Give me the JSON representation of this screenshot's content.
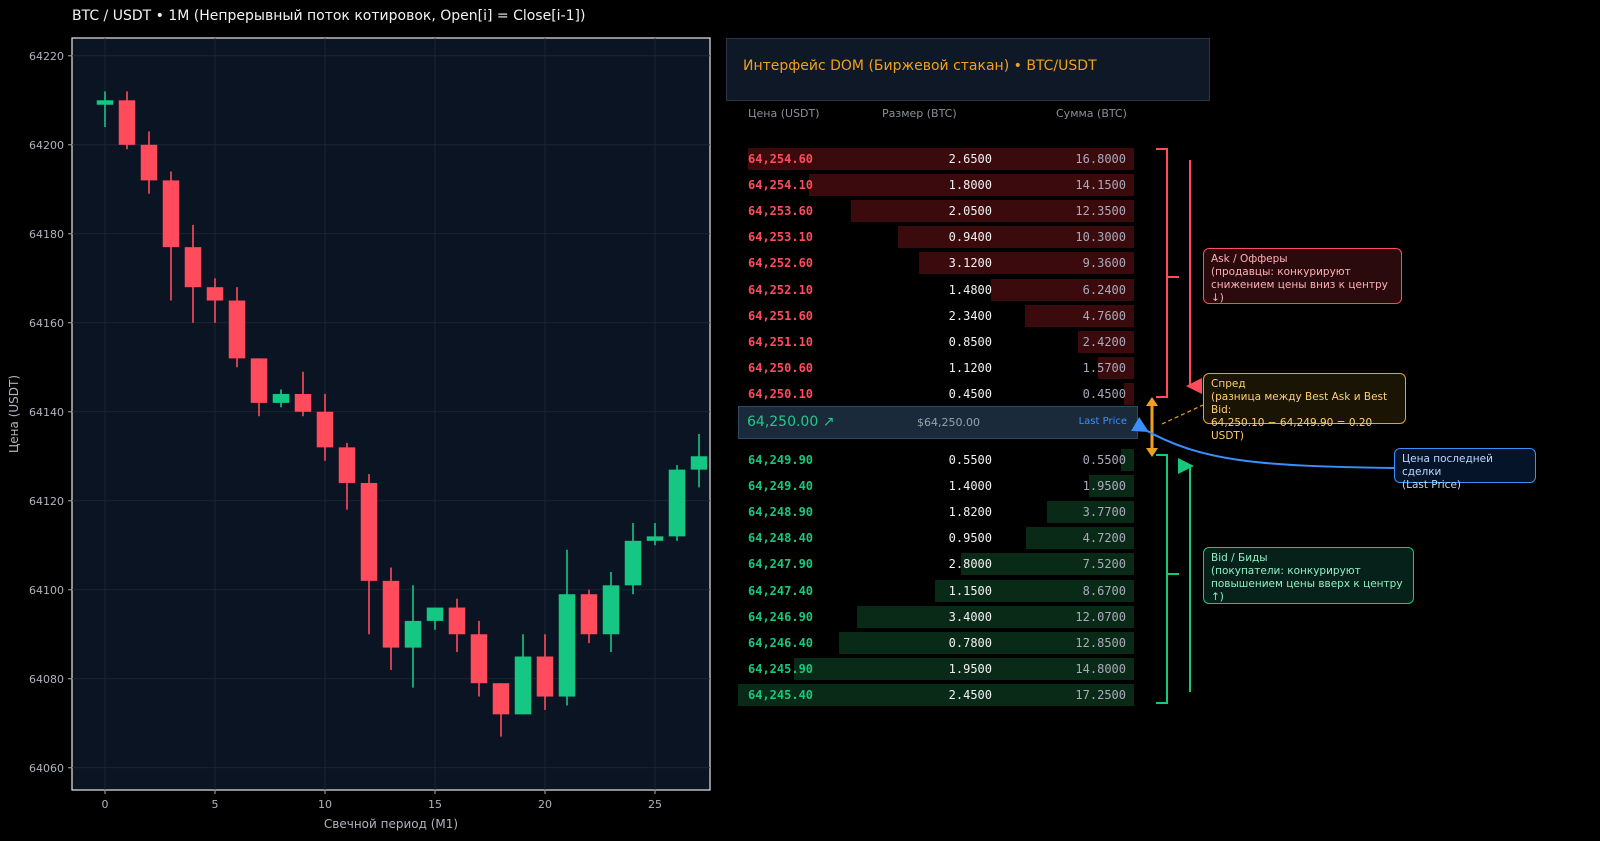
{
  "title": "BTC / USDT • 1M  (Непрерывный поток котировок, Open[i] = Close[i-1])",
  "colors": {
    "up": "#16c784",
    "down": "#ff4b5c",
    "accent": "#f0a020",
    "last": "#3a8fff",
    "background": "#000000",
    "plot_bg": "#0b1422"
  },
  "chart_data": {
    "type": "candlestick",
    "xlabel": "Свечной период (M1)",
    "ylabel": "Цена (USDT)",
    "xlim": [
      -1.5,
      27.5
    ],
    "ylim": [
      64055,
      64224
    ],
    "xticks": [
      0,
      5,
      10,
      15,
      20,
      25
    ],
    "yticks": [
      64060,
      64080,
      64100,
      64120,
      64140,
      64160,
      64180,
      64200,
      64220
    ],
    "grid": true,
    "candles": [
      {
        "x": 0,
        "open": 64209,
        "high": 64212,
        "low": 64204,
        "close": 64210
      },
      {
        "x": 1,
        "open": 64210,
        "high": 64212,
        "low": 64199,
        "close": 64200
      },
      {
        "x": 2,
        "open": 64200,
        "high": 64203,
        "low": 64189,
        "close": 64192
      },
      {
        "x": 3,
        "open": 64192,
        "high": 64194,
        "low": 64165,
        "close": 64177
      },
      {
        "x": 4,
        "open": 64177,
        "high": 64182,
        "low": 64160,
        "close": 64168
      },
      {
        "x": 5,
        "open": 64168,
        "high": 64170,
        "low": 64160,
        "close": 64165
      },
      {
        "x": 6,
        "open": 64165,
        "high": 64168,
        "low": 64150,
        "close": 64152
      },
      {
        "x": 7,
        "open": 64152,
        "high": 64152,
        "low": 64139,
        "close": 64142
      },
      {
        "x": 8,
        "open": 64142,
        "high": 64145,
        "low": 64141,
        "close": 64144
      },
      {
        "x": 9,
        "open": 64144,
        "high": 64149,
        "low": 64139,
        "close": 64140
      },
      {
        "x": 10,
        "open": 64140,
        "high": 64144,
        "low": 64129,
        "close": 64132
      },
      {
        "x": 11,
        "open": 64132,
        "high": 64133,
        "low": 64118,
        "close": 64124
      },
      {
        "x": 12,
        "open": 64124,
        "high": 64126,
        "low": 64090,
        "close": 64102
      },
      {
        "x": 13,
        "open": 64102,
        "high": 64105,
        "low": 64082,
        "close": 64087
      },
      {
        "x": 14,
        "open": 64087,
        "high": 64101,
        "low": 64078,
        "close": 64093
      },
      {
        "x": 15,
        "open": 64093,
        "high": 64096,
        "low": 64091,
        "close": 64096
      },
      {
        "x": 16,
        "open": 64096,
        "high": 64098,
        "low": 64086,
        "close": 64090
      },
      {
        "x": 17,
        "open": 64090,
        "high": 64093,
        "low": 64076,
        "close": 64079
      },
      {
        "x": 18,
        "open": 64079,
        "high": 64079,
        "low": 64067,
        "close": 64072
      },
      {
        "x": 19,
        "open": 64072,
        "high": 64090,
        "low": 64072,
        "close": 64085
      },
      {
        "x": 20,
        "open": 64085,
        "high": 64090,
        "low": 64073,
        "close": 64076
      },
      {
        "x": 21,
        "open": 64076,
        "high": 64109,
        "low": 64074,
        "close": 64099
      },
      {
        "x": 22,
        "open": 64099,
        "high": 64100,
        "low": 64088,
        "close": 64090
      },
      {
        "x": 23,
        "open": 64090,
        "high": 64104,
        "low": 64086,
        "close": 64101
      },
      {
        "x": 24,
        "open": 64101,
        "high": 64115,
        "low": 64099,
        "close": 64111
      },
      {
        "x": 25,
        "open": 64111,
        "high": 64115,
        "low": 64110,
        "close": 64112
      },
      {
        "x": 26,
        "open": 64112,
        "high": 64128,
        "low": 64111,
        "close": 64127
      },
      {
        "x": 27,
        "open": 64127,
        "high": 64135,
        "low": 64123,
        "close": 64130
      }
    ]
  },
  "dom": {
    "title": "Интерфейс DOM (Биржевой стакан) • BTC/USDT",
    "columns": [
      "Цена (USDT)",
      "Размер (BTC)",
      "Сумма (BTC)"
    ],
    "max_total": 17.25,
    "asks": [
      {
        "price": "64,254.60",
        "size": "2.6500",
        "total": "16.8000",
        "total_value": 16.8
      },
      {
        "price": "64,254.10",
        "size": "1.8000",
        "total": "14.1500",
        "total_value": 14.15
      },
      {
        "price": "64,253.60",
        "size": "2.0500",
        "total": "12.3500",
        "total_value": 12.35
      },
      {
        "price": "64,253.10",
        "size": "0.9400",
        "total": "10.3000",
        "total_value": 10.3
      },
      {
        "price": "64,252.60",
        "size": "3.1200",
        "total": "9.3600",
        "total_value": 9.36
      },
      {
        "price": "64,252.10",
        "size": "1.4800",
        "total": "6.2400",
        "total_value": 6.24
      },
      {
        "price": "64,251.60",
        "size": "2.3400",
        "total": "4.7600",
        "total_value": 4.76
      },
      {
        "price": "64,251.10",
        "size": "0.8500",
        "total": "2.4200",
        "total_value": 2.42
      },
      {
        "price": "64,250.60",
        "size": "1.1200",
        "total": "1.5700",
        "total_value": 1.57
      },
      {
        "price": "64,250.10",
        "size": "0.4500",
        "total": "0.4500",
        "total_value": 0.45
      }
    ],
    "last_price": "64,250.00 ↗",
    "last_price_fiat": "$64,250.00",
    "last_label": "Last Price",
    "bids": [
      {
        "price": "64,249.90",
        "size": "0.5500",
        "total": "0.5500",
        "total_value": 0.55
      },
      {
        "price": "64,249.40",
        "size": "1.4000",
        "total": "1.9500",
        "total_value": 1.95
      },
      {
        "price": "64,248.90",
        "size": "1.8200",
        "total": "3.7700",
        "total_value": 3.77
      },
      {
        "price": "64,248.40",
        "size": "0.9500",
        "total": "4.7200",
        "total_value": 4.72
      },
      {
        "price": "64,247.90",
        "size": "2.8000",
        "total": "7.5200",
        "total_value": 7.52
      },
      {
        "price": "64,247.40",
        "size": "1.1500",
        "total": "8.6700",
        "total_value": 8.67
      },
      {
        "price": "64,246.90",
        "size": "3.4000",
        "total": "12.0700",
        "total_value": 12.07
      },
      {
        "price": "64,246.40",
        "size": "0.7800",
        "total": "12.8500",
        "total_value": 12.85
      },
      {
        "price": "64,245.90",
        "size": "1.9500",
        "total": "14.8000",
        "total_value": 14.8
      },
      {
        "price": "64,245.40",
        "size": "2.4500",
        "total": "17.2500",
        "total_value": 17.25
      }
    ]
  },
  "annotations": {
    "ask": [
      "Ask / Офферы",
      "(продавцы: конкурируют",
      "снижением цены вниз к центру ↓)"
    ],
    "spread": [
      "Спред",
      "(разница между Best Ask и Best Bid:",
      "64,250.10 − 64,249.90 = 0.20 USDT)"
    ],
    "last": [
      "Цена последней сделки",
      "(Last Price)"
    ],
    "bid": [
      "Bid / Биды",
      "(покупатели: конкурируют",
      "повышением цены вверх к центру ↑)"
    ]
  }
}
